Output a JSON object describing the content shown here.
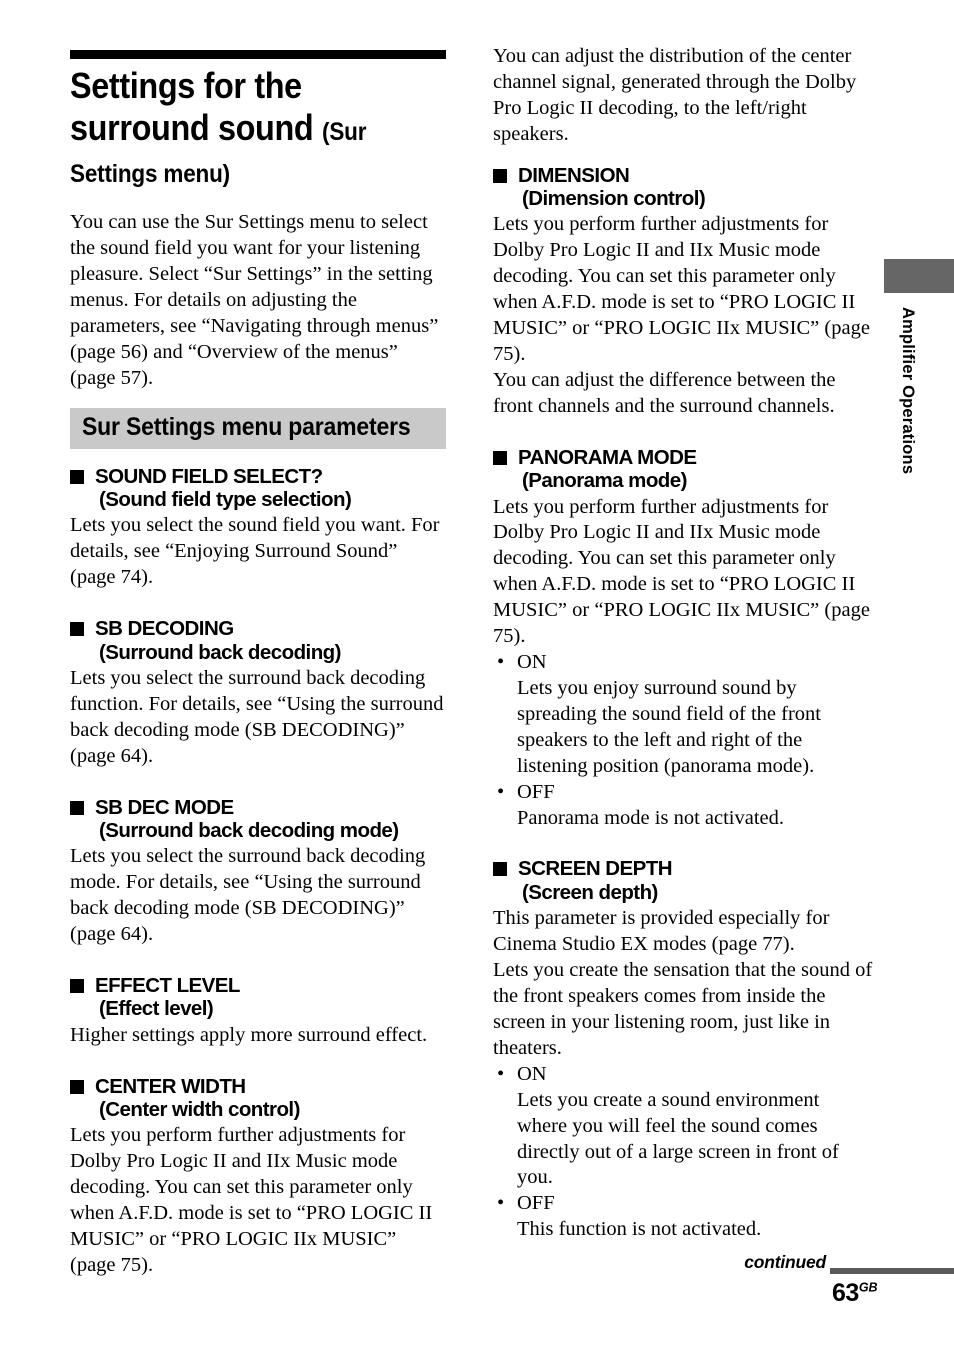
{
  "page": {
    "number": "63",
    "region_suffix": "GB",
    "continued_label": "continued",
    "side_tab_label": "Amplifier Operations",
    "colors": {
      "title_rule": "#000000",
      "section_bar": "#c9c9c9",
      "side_tab_block": "#666666",
      "footer_rule": "#5a5a5a"
    }
  },
  "title": {
    "main": "Settings for the surround sound",
    "subtitle": "(Sur Settings menu)"
  },
  "intro": "You can use the Sur Settings menu to select the sound field you want for your listening pleasure. Select “Sur Settings” in the setting menus. For details on adjusting the parameters, see “Navigating through menus” (page 56) and “Overview of the menus” (page 57).",
  "section_bar": {
    "label": "Sur Settings menu parameters"
  },
  "left_column": {
    "entries": [
      {
        "head_line1": "SOUND FIELD SELECT?",
        "head_line2": "(Sound field type selection)",
        "paragraphs": [
          "Lets you select the sound field you want. For details, see “Enjoying Surround Sound” (page 74)."
        ]
      },
      {
        "head_line1": "SB DECODING",
        "head_line2": "(Surround back decoding)",
        "paragraphs": [
          "Lets you select the surround back decoding function. For details, see “Using the surround back decoding mode (SB DECODING)” (page 64)."
        ]
      },
      {
        "head_line1": "SB DEC MODE",
        "head_line2": "(Surround back decoding mode)",
        "paragraphs": [
          "Lets you select the surround back decoding mode. For details, see “Using the surround back decoding mode (SB DECODING)” (page 64)."
        ]
      },
      {
        "head_line1": "EFFECT LEVEL",
        "head_line2": "(Effect level)",
        "paragraphs": [
          "Higher settings apply more surround effect."
        ]
      },
      {
        "head_line1": "CENTER WIDTH",
        "head_line2": "(Center width control)",
        "paragraphs": [
          "Lets you perform further adjustments for Dolby Pro Logic II and IIx Music mode decoding. You can set this parameter only when A.F.D. mode is set to “PRO LOGIC II MUSIC” or “PRO LOGIC IIx MUSIC” (page 75)."
        ]
      }
    ]
  },
  "right_column": {
    "lead_paragraph": "You can adjust the distribution of the center channel signal, generated through the Dolby Pro Logic II decoding, to the left/right speakers.",
    "entries": [
      {
        "head_line1": "DIMENSION",
        "head_line2": "(Dimension control)",
        "paragraphs": [
          "Lets you perform further adjustments for Dolby Pro Logic II and IIx Music mode decoding. You can set this parameter only when A.F.D. mode is set to “PRO LOGIC II MUSIC” or “PRO LOGIC IIx MUSIC” (page 75).",
          "You can adjust the difference between the front channels and the surround channels."
        ],
        "options": []
      },
      {
        "head_line1": "PANORAMA MODE",
        "head_line2": "(Panorama mode)",
        "paragraphs": [
          "Lets you perform further adjustments for Dolby Pro Logic II and IIx Music mode decoding. You can set this parameter only when A.F.D. mode is set to “PRO LOGIC II MUSIC” or “PRO LOGIC IIx MUSIC” (page 75)."
        ],
        "options": [
          {
            "name": "ON",
            "desc": "Lets you enjoy surround sound by spreading the sound field of the front speakers to the left and right of the listening position (panorama mode)."
          },
          {
            "name": "OFF",
            "desc": "Panorama mode is not activated."
          }
        ]
      },
      {
        "head_line1": "SCREEN DEPTH",
        "head_line2": "(Screen depth)",
        "paragraphs": [
          "This parameter is provided especially for Cinema Studio EX modes (page 77).",
          "Lets you create the sensation that the sound of the front speakers comes from inside the screen in your listening room, just like in theaters."
        ],
        "options": [
          {
            "name": "ON",
            "desc": "Lets you create a sound environment where you will feel the sound comes directly out of a large screen in front of you."
          },
          {
            "name": "OFF",
            "desc": "This function is not activated."
          }
        ]
      }
    ]
  }
}
